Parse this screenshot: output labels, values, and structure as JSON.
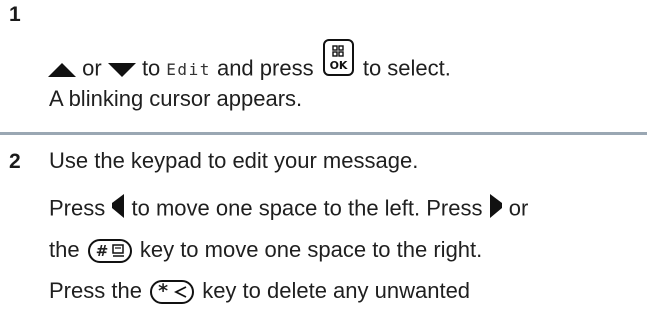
{
  "step1": {
    "number": "1",
    "lead_word": "or",
    "text_before_mono": "to",
    "menu_item": "Edit",
    "text_after_mono": "and press",
    "text_end": "to select.",
    "line2": "A blinking cursor appears.",
    "ok_key_label": "OK"
  },
  "step2": {
    "number": "2",
    "line1": "Use the keypad to edit your message.",
    "line2_a": "Press",
    "line2_b": "to move one space to the left. Press",
    "line2_c": "or",
    "line3_a": "the",
    "line3_b": "key to move one space to the right.",
    "line4_a": "Press the",
    "line4_b": "key to delete any unwanted",
    "hash_key_label": "#",
    "star_key_label": "*"
  },
  "icons": {
    "up": "up-arrow-icon",
    "down": "down-arrow-icon",
    "menu_ok": "menu-ok-key-icon",
    "left": "left-arrow-icon",
    "right": "right-arrow-icon",
    "hash": "hash-key-icon",
    "star": "star-key-icon"
  },
  "colors": {
    "divider": "#9aa7b3",
    "text": "#1f1f1f"
  }
}
